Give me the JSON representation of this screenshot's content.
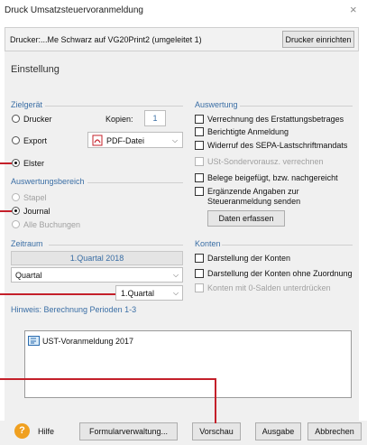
{
  "window": {
    "title": "Druck Umsatzsteuervoranmeldung",
    "close_glyph": "×"
  },
  "printer": {
    "label": "Drucker:...Me Schwarz auf VG20Print2 (umgeleitet 1)",
    "setup_button": "Drucker einrichten"
  },
  "heading": "Einstellung",
  "zielgeraet": {
    "title": "Zielgerät",
    "drucker": "Drucker",
    "kopien_label": "Kopien:",
    "kopien_value": "1",
    "export": "Export",
    "export_format": "PDF-Datei",
    "elster": "Elster",
    "selected": "Elster"
  },
  "auswertungsbereich": {
    "title": "Auswertungsbereich",
    "stapel": "Stapel",
    "journal": "Journal",
    "alle": "Alle Buchungen",
    "selected": "Journal"
  },
  "zeitraum": {
    "title": "Zeitraum",
    "display": "1.Quartal 2018",
    "period_type": "Quartal",
    "period_value": "1.Quartal"
  },
  "hinweis": "Hinweis: Berechnung Perioden 1-3",
  "auswertung": {
    "title": "Auswertung",
    "items": [
      {
        "label": "Verrechnung des Erstattungsbetrages",
        "enabled": true
      },
      {
        "label": "Berichtigte Anmeldung",
        "enabled": true
      },
      {
        "label": "Widerruf des SEPA-Lastschriftmandats",
        "enabled": true
      },
      {
        "label": "USt-Sondervorausz. verrechnen",
        "enabled": false
      },
      {
        "label": "Belege beigefügt, bzw. nachgereicht",
        "enabled": true
      },
      {
        "label": "Ergänzende Angaben zur",
        "label2": "Steueranmeldung senden",
        "enabled": true
      }
    ],
    "daten_button": "Daten erfassen"
  },
  "konten": {
    "title": "Konten",
    "items": [
      {
        "label": "Darstellung der Konten",
        "enabled": true
      },
      {
        "label": "Darstellung der Konten ohne Zuordnung",
        "enabled": true
      },
      {
        "label": "Konten mit 0-Salden unterdrücken",
        "enabled": false
      }
    ]
  },
  "list": {
    "items": [
      "UST-Voranmeldung 2017"
    ]
  },
  "footer": {
    "hilfe": "Hilfe",
    "formular": "Formularverwaltung...",
    "vorschau": "Vorschau",
    "ausgabe": "Ausgabe",
    "abbrechen": "Abbrechen"
  },
  "colors": {
    "annotation_line": "#c4202a",
    "section_title": "#3a6ea5",
    "help_icon": "#f0a020"
  }
}
